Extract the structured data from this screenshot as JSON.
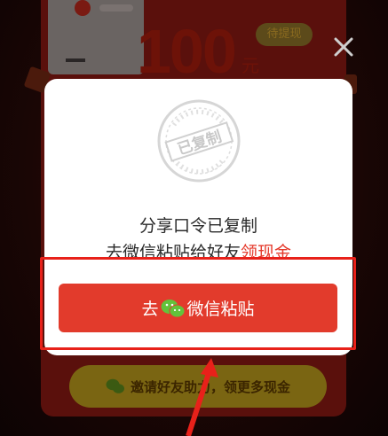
{
  "background": {
    "amount": "100",
    "unit": "元",
    "badge": "待提现",
    "dash": "–",
    "invite_button": "邀请好友助力，领更多现金"
  },
  "modal": {
    "stamp_text": "已复制",
    "line1": "分享口令已复制",
    "line2_prefix": "去微信粘贴给好友",
    "line2_highlight": "领现金",
    "button_prefix": "去",
    "button_suffix": "微信粘贴"
  },
  "icons": {
    "close": "close-icon",
    "wechat": "wechat-icon",
    "stamp": "copied-stamp-icon"
  },
  "colors": {
    "accent": "#e23b2c",
    "highlight": "#e5392b",
    "annotation": "#e8211a",
    "wechat_green": "#62c33b"
  }
}
